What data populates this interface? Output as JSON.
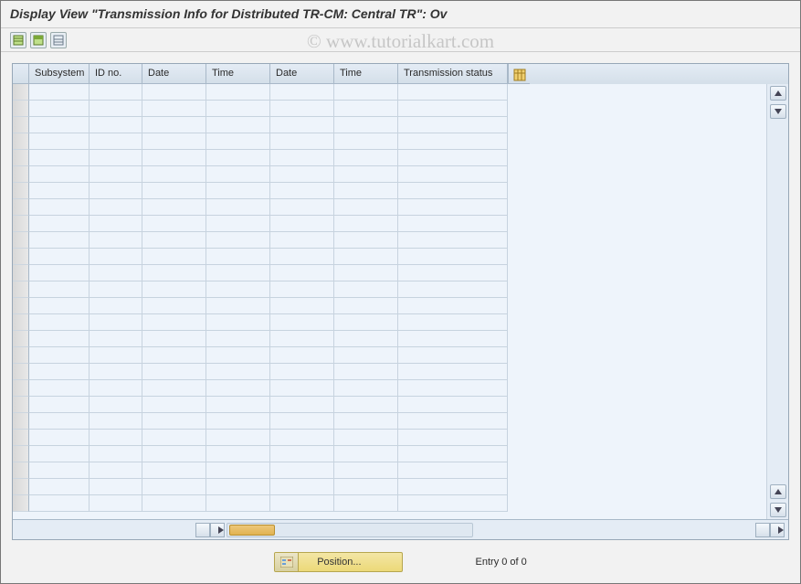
{
  "window": {
    "title": "Display View \"Transmission Info for Distributed TR-CM: Central TR\": Ov"
  },
  "watermark": "© www.tutorialkart.com",
  "toolbar": {
    "btn1_name": "select-all-icon",
    "btn2_name": "select-block-icon",
    "btn3_name": "deselect-all-icon"
  },
  "grid": {
    "columns": [
      {
        "label": "Subsystem"
      },
      {
        "label": "ID no."
      },
      {
        "label": "Date"
      },
      {
        "label": "Time"
      },
      {
        "label": "Date"
      },
      {
        "label": "Time"
      },
      {
        "label": "Transmission status"
      }
    ],
    "row_count": 26
  },
  "footer": {
    "position_label": "Position...",
    "entry_text": "Entry 0 of 0"
  }
}
